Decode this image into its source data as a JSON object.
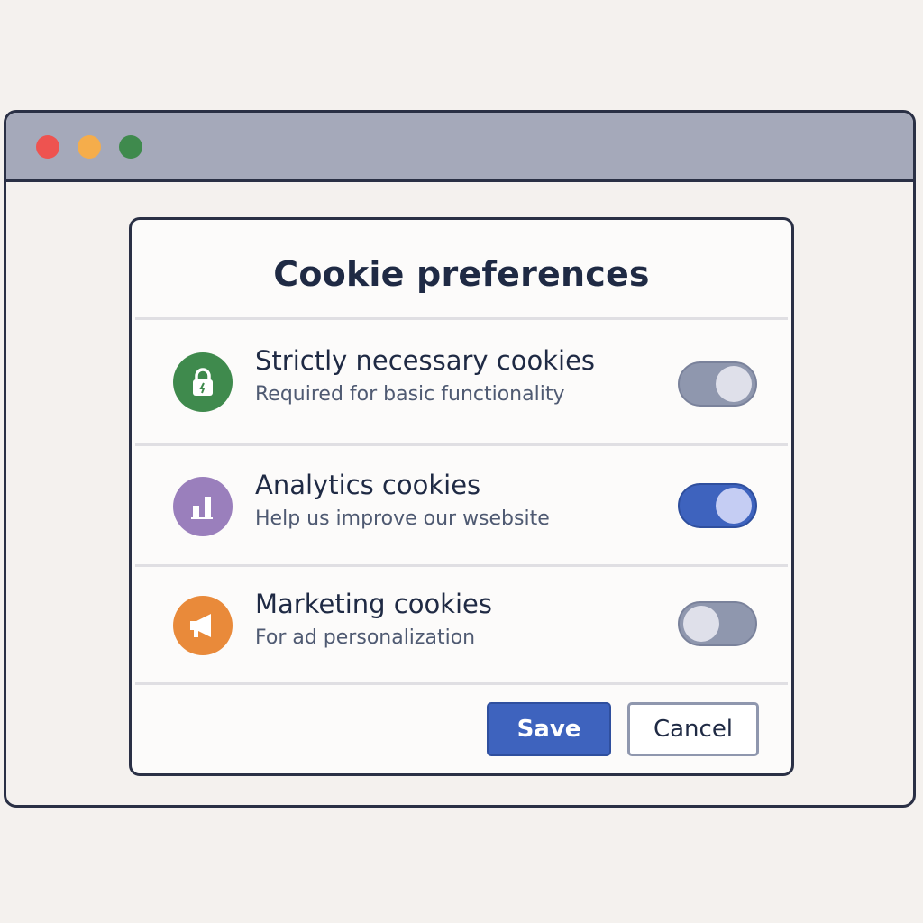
{
  "window": {
    "controls": [
      "close",
      "minimize",
      "maximize"
    ]
  },
  "dialog": {
    "title": "Cookie preferences",
    "categories": [
      {
        "title": "Strictly necessary cookies",
        "description": "Required for basic functionality",
        "icon": "lock-icon",
        "icon_color": "#3f8a4d",
        "enabled": true,
        "locked": true
      },
      {
        "title": "Analytics cookies",
        "description": "Help us improve our wsebsite",
        "icon": "bar-chart-icon",
        "icon_color": "#9a7fbc",
        "enabled": true,
        "locked": false
      },
      {
        "title": "Marketing cookies",
        "description": "For ad personalization",
        "icon": "megaphone-icon",
        "icon_color": "#e98a3a",
        "enabled": false,
        "locked": false
      }
    ],
    "save_label": "Save",
    "cancel_label": "Cancel"
  },
  "colors": {
    "accent": "#3e63be",
    "toggle_off": "#8f97ae",
    "background": "#f4f1ee"
  }
}
